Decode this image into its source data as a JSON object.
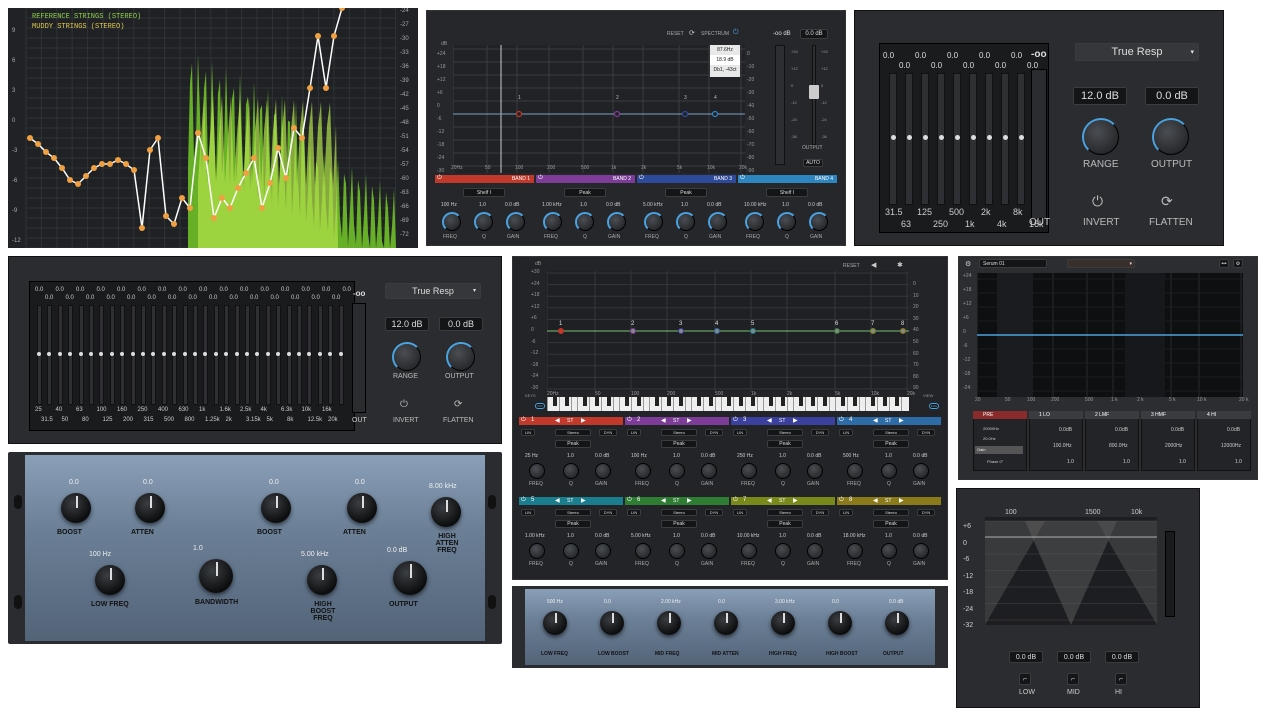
{
  "spectrum": {
    "legend_ref": "REFERENCE STRINGS (STEREO)",
    "legend_muddy": "MUDDY STRINGS (STEREO)",
    "left_ticks": [
      "9",
      "6",
      "3",
      "0",
      "-3",
      "-6",
      "-9",
      "-12"
    ],
    "right_ticks": [
      "-24",
      "-27",
      "-30",
      "-33",
      "-36",
      "-39",
      "-42",
      "-45",
      "-48",
      "-51",
      "-54",
      "-57",
      "-60",
      "-63",
      "-66",
      "-69",
      "-72"
    ],
    "colors": {
      "ref": "#ffffff",
      "muddy": "#7fd02a",
      "dots": "#f0a040"
    }
  },
  "eq4": {
    "reset": "RESET",
    "spectrum": "SPECTRUM",
    "db_unit": "dB",
    "input_db": "-oo dB",
    "out_db": "0.0 dB",
    "output": "OUTPUT",
    "auto": "AUTO",
    "tooltip": [
      "87.6Hz",
      "18.9 dB",
      "Db1, -43ct"
    ],
    "left_ticks": [
      "+24",
      "+18",
      "+12",
      "+6",
      "0",
      "-6",
      "-12",
      "-18",
      "-24",
      "-30"
    ],
    "right_ticks": [
      "0",
      "-10",
      "-20",
      "-30",
      "-40",
      "-50",
      "-60",
      "-70",
      "-80",
      "-90"
    ],
    "meter_ticks": [
      "+24",
      "+12",
      "0",
      "-12",
      "-24",
      "-36"
    ],
    "freq_ticks": [
      "20Hz",
      "50",
      "100",
      "200",
      "500",
      "1k",
      "2k",
      "5k",
      "10k",
      "20k"
    ],
    "nodes": [
      "1",
      "2",
      "3",
      "4"
    ],
    "bands": [
      {
        "name": "BAND 1",
        "type": "Shelf I",
        "freq": "100 Hz",
        "q": "1.0",
        "gain": "0.0 dB",
        "color": "#c0392b"
      },
      {
        "name": "BAND 2",
        "type": "Peak",
        "freq": "1.00 kHz",
        "q": "1.0",
        "gain": "0.0 dB",
        "color": "#7d3c98"
      },
      {
        "name": "BAND 3",
        "type": "Peak",
        "freq": "5.00 kHz",
        "q": "1.0",
        "gain": "0.0 dB",
        "color": "#2e4a9a"
      },
      {
        "name": "BAND 4",
        "type": "Shelf I",
        "freq": "10.00 kHz",
        "q": "1.0",
        "gain": "0.0 dB",
        "color": "#2e86c1"
      }
    ],
    "knob_labels": {
      "freq": "FREQ",
      "q": "Q",
      "gain": "GAIN"
    }
  },
  "geq10": {
    "out_db": "-oo",
    "mode": "True Resp",
    "range_val": "12.0 dB",
    "output_val": "0.0 dB",
    "range": "RANGE",
    "output": "OUTPUT",
    "invert": "INVERT",
    "flatten": "FLATTEN",
    "top_vals": [
      "0.0",
      "0.0",
      "0.0",
      "0.0",
      "0.0",
      "0.0",
      "0.0",
      "0.0",
      "0.0",
      "0.0"
    ],
    "freq_top": [
      "31.5",
      "125",
      "500",
      "2k",
      "8k"
    ],
    "freq_bot": [
      "63",
      "250",
      "1k",
      "4k",
      "16k"
    ],
    "out": "OUT"
  },
  "geq30": {
    "out_db": "-oo",
    "mode": "True Resp",
    "range_val": "12.0 dB",
    "output_val": "0.0 dB",
    "range": "RANGE",
    "output": "OUTPUT",
    "invert": "INVERT",
    "flatten": "FLATTEN",
    "top_vals": [
      "0.0",
      "0.0",
      "0.0",
      "0.0",
      "0.0",
      "0.0",
      "0.0",
      "0.0",
      "0.0",
      "0.0",
      "0.0",
      "0.0",
      "0.0",
      "0.0",
      "0.0",
      "0.0"
    ],
    "bot_vals": [
      "0.0",
      "0.0",
      "0.0",
      "0.0",
      "0.0",
      "0.0",
      "0.0",
      "0.0",
      "0.0",
      "0.0",
      "0.0",
      "0.0",
      "0.0",
      "0.0",
      "0.0"
    ],
    "freq_top": [
      "25",
      "40",
      "63",
      "100",
      "160",
      "250",
      "400",
      "630",
      "1k",
      "1.6k",
      "2.5k",
      "4k",
      "6.3k",
      "10k",
      "16k"
    ],
    "freq_bot": [
      "31.5",
      "50",
      "80",
      "125",
      "200",
      "315",
      "500",
      "800",
      "1.25k",
      "2k",
      "3.15k",
      "5k",
      "8k",
      "12.5k",
      "20k"
    ],
    "out": "OUT"
  },
  "eq8": {
    "reset": "RESET",
    "db": "dB",
    "left_ticks": [
      "+30",
      "+24",
      "+18",
      "+12",
      "+6",
      "0",
      "-6",
      "-12",
      "-18",
      "-24",
      "-30"
    ],
    "right_ticks": [
      "0",
      "10",
      "20",
      "30",
      "40",
      "50",
      "60",
      "70",
      "80",
      "90"
    ],
    "freq_ticks": [
      "20Hz",
      "50",
      "100",
      "200",
      "500",
      "1k",
      "2k",
      "5k",
      "10k",
      "20k"
    ],
    "nodes": [
      "1",
      "2",
      "3",
      "4",
      "5",
      "6",
      "7",
      "8"
    ],
    "keys": "KEYS",
    "view": "VIEW",
    "off": "OFF",
    "eng": "ENG",
    "bands": [
      {
        "num": "1",
        "color": "#c0392b",
        "freq": "25 Hz",
        "q": "1.0",
        "gain": "0.0 dB"
      },
      {
        "num": "2",
        "color": "#7d3c98",
        "freq": "100 Hz",
        "q": "1.0",
        "gain": "0.0 dB"
      },
      {
        "num": "3",
        "color": "#3b3f9e",
        "freq": "250 Hz",
        "q": "1.0",
        "gain": "0.0 dB"
      },
      {
        "num": "4",
        "color": "#2e6ca8",
        "freq": "500 Hz",
        "q": "1.0",
        "gain": "0.0 dB"
      },
      {
        "num": "5",
        "color": "#1a7e8e",
        "freq": "1.00 kHz",
        "q": "1.0",
        "gain": "0.0 dB"
      },
      {
        "num": "6",
        "color": "#2e7d32",
        "freq": "5.00 kHz",
        "q": "1.0",
        "gain": "0.0 dB"
      },
      {
        "num": "7",
        "color": "#7a8a1a",
        "freq": "10.00 kHz",
        "q": "1.0",
        "gain": "0.0 dB"
      },
      {
        "num": "8",
        "color": "#8a7a1a",
        "freq": "18.00 kHz",
        "q": "1.0",
        "gain": "0.0 dB"
      }
    ],
    "st": "ST",
    "lin": "LIN",
    "dyn": "DYN",
    "stereo": "Stereo",
    "peak": "Peak",
    "freq": "FREQ",
    "q": "Q",
    "gain": "GAIN"
  },
  "serum": {
    "title": "Serum 01",
    "left_ticks": [
      "+24",
      "+18",
      "+12",
      "+6",
      "0",
      "-6",
      "-12",
      "-18",
      "-24"
    ],
    "freq_ticks": [
      "20",
      "50",
      "100",
      "200",
      "500",
      "1 k",
      "2 k",
      "5 k",
      "10 k",
      "20 k"
    ],
    "bands": [
      {
        "name": "PRE",
        "a": "20000Hz",
        "b": "20.0Hz",
        "c": "Gain",
        "d": "Phase 0°"
      },
      {
        "name": "1 LO",
        "a": "0.0dB",
        "b": "100.0Hz",
        "c": "1.0"
      },
      {
        "name": "2 LMF",
        "a": "0.0dB",
        "b": "800.0Hz",
        "c": "1.0"
      },
      {
        "name": "3 HMF",
        "a": "0.0dB",
        "b": "2000Hz",
        "c": "1.0"
      },
      {
        "name": "4 HI",
        "a": "0.0dB",
        "b": "12000Hz",
        "c": "1.0"
      }
    ]
  },
  "pultec1": {
    "vals": [
      "0.0",
      "0.0",
      "0.0",
      "0.0",
      "8.00 kHz",
      "100 Hz",
      "1.0",
      "5.00 kHz",
      "0.0 dB"
    ],
    "labels": [
      "BOOST",
      "ATTEN",
      "BOOST",
      "ATTEN",
      "HIGH ATTEN FREQ",
      "LOW FREQ",
      "BANDWIDTH",
      "HIGH BOOST FREQ",
      "OUTPUT"
    ]
  },
  "pultec2": {
    "vals": [
      "500 Hz",
      "0.0",
      "2.00 kHz",
      "0.0",
      "3.00 kHz",
      "0.0",
      "0.0 dB"
    ],
    "labels": [
      "LOW FREQ",
      "LOW BOOST",
      "MID FREQ",
      "MID ATTEN",
      "HIGH FREQ",
      "HIGH BOOST",
      "OUTPUT"
    ]
  },
  "dj": {
    "freq_ticks": [
      "100",
      "1500",
      "10k"
    ],
    "left_ticks": [
      "+6",
      "0",
      "-6",
      "-12",
      "-18",
      "-24",
      "-32"
    ],
    "vals": [
      "0.0 dB",
      "0.0 dB",
      "0.0 dB"
    ],
    "labels": [
      "LOW",
      "MID",
      "HI"
    ]
  }
}
